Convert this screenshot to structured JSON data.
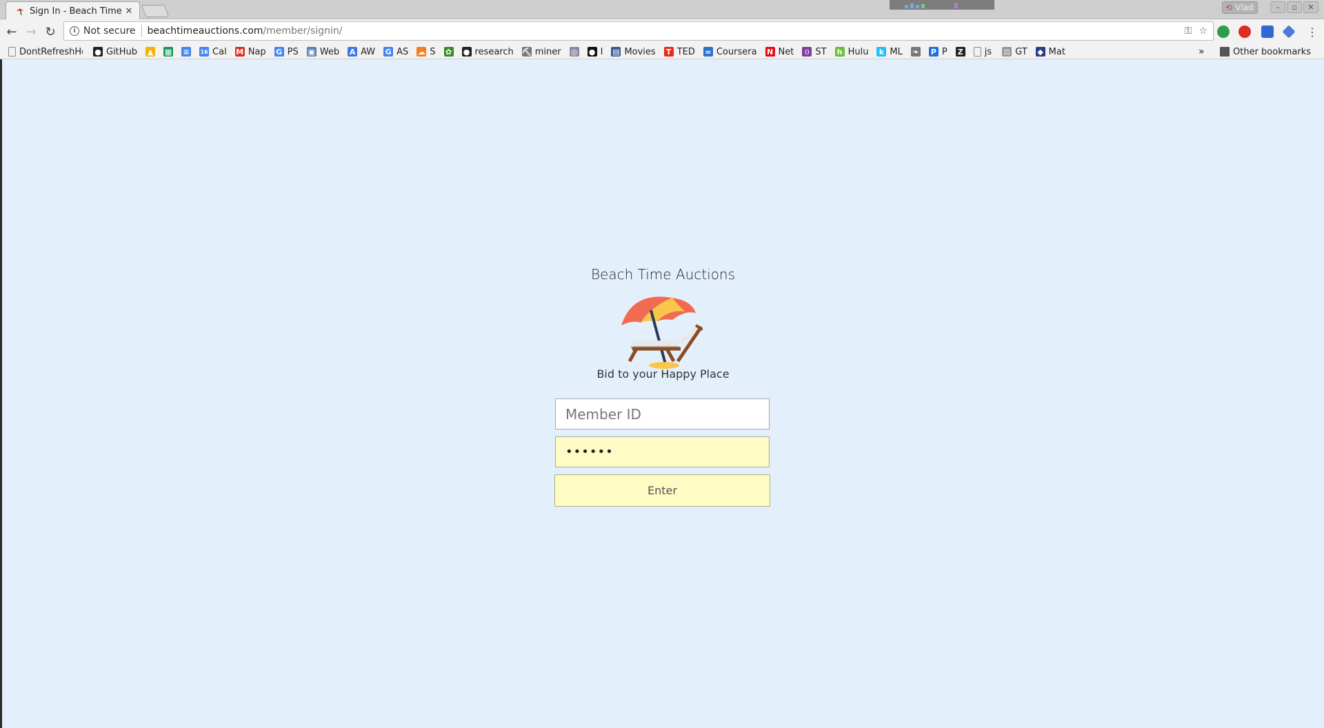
{
  "browser": {
    "tab_title": "Sign In - Beach Time Auctions",
    "tab_close": "✕",
    "profile_name": "Vlad",
    "security_label": "Not secure",
    "url_host": "beachtimeauctions.com",
    "url_path": "/member/signin/"
  },
  "bookmarks": [
    {
      "label": "DontRefreshHold",
      "icon": "page-icon",
      "color": "#888888",
      "glyph": ""
    },
    {
      "label": "GitHub",
      "icon": "github-icon",
      "color": "#222222",
      "glyph": "●"
    },
    {
      "label": "",
      "icon": "google-drive-icon",
      "color": "#f4b400",
      "glyph": "▲"
    },
    {
      "label": "",
      "icon": "google-sheets-icon",
      "color": "#0f9d58",
      "glyph": "▦"
    },
    {
      "label": "",
      "icon": "google-docs-icon",
      "color": "#4285f4",
      "glyph": "≡"
    },
    {
      "label": "Cal",
      "icon": "google-calendar-icon",
      "color": "#4285f4",
      "glyph": "16"
    },
    {
      "label": "Nap",
      "icon": "gmail-icon",
      "color": "#d93025",
      "glyph": "M"
    },
    {
      "label": "PS",
      "icon": "google-icon",
      "color": "#4285f4",
      "glyph": "G"
    },
    {
      "label": "Web",
      "icon": "web-icon",
      "color": "#5b7fb8",
      "glyph": "▣"
    },
    {
      "label": "AW",
      "icon": "adwords-icon",
      "color": "#3b78e7",
      "glyph": "A"
    },
    {
      "label": "AS",
      "icon": "google-icon",
      "color": "#4285f4",
      "glyph": "G"
    },
    {
      "label": "S",
      "icon": "cloud-icon",
      "color": "#f38020",
      "glyph": "☁"
    },
    {
      "label": "",
      "icon": "gear-flower-icon",
      "color": "#3b8c2a",
      "glyph": "✿"
    },
    {
      "label": "research",
      "icon": "github-icon",
      "color": "#222222",
      "glyph": "●"
    },
    {
      "label": "miner",
      "icon": "pick-icon",
      "color": "#777777",
      "glyph": "⛏"
    },
    {
      "label": "",
      "icon": "globe-icon",
      "color": "#8a8aa8",
      "glyph": "◎"
    },
    {
      "label": "I",
      "icon": "dark-app-icon",
      "color": "#111111",
      "glyph": "●"
    },
    {
      "label": "Movies",
      "icon": "movie-icon",
      "color": "#3a5a9a",
      "glyph": "▤"
    },
    {
      "label": "TED",
      "icon": "ted-icon",
      "color": "#e62b1e",
      "glyph": "T"
    },
    {
      "label": "Coursera",
      "icon": "coursera-icon",
      "color": "#2a73cc",
      "glyph": "∞"
    },
    {
      "label": "Net",
      "icon": "netflix-icon",
      "color": "#e50914",
      "glyph": "N"
    },
    {
      "label": "ST",
      "icon": "code-icon",
      "color": "#7e3fa1",
      "glyph": "⟨⟩"
    },
    {
      "label": "Hulu",
      "icon": "hulu-icon",
      "color": "#6abf3b",
      "glyph": "h"
    },
    {
      "label": "ML",
      "icon": "kaggle-icon",
      "color": "#20beff",
      "glyph": "k"
    },
    {
      "label": "",
      "icon": "leaf-icon",
      "color": "#777777",
      "glyph": "❧"
    },
    {
      "label": "P",
      "icon": "paypal-icon",
      "color": "#1e6fd9",
      "glyph": "P"
    },
    {
      "label": "",
      "icon": "z-icon",
      "color": "#222222",
      "glyph": "Z"
    },
    {
      "label": "js",
      "icon": "page-icon",
      "color": "#888888",
      "glyph": ""
    },
    {
      "label": "GT",
      "icon": "scale-icon",
      "color": "#999999",
      "glyph": "⚖"
    },
    {
      "label": "Mat",
      "icon": "shield-icon",
      "color": "#2b3a8a",
      "glyph": "◆"
    }
  ],
  "bookmarks_overflow": "»",
  "other_bookmarks": "Other bookmarks",
  "page": {
    "brand_title": "Beach Time Auctions",
    "tagline": "Bid to your Happy Place",
    "member_id_placeholder": "Member ID",
    "password_value": "••••••",
    "enter_label": "Enter"
  },
  "colors": {
    "page_bg": "#e3f0fb",
    "autofill_bg": "#fefbc4",
    "umbrella_red": "#f26a4f",
    "umbrella_yellow": "#f9c54a",
    "chair_wood": "#8b4b23"
  }
}
